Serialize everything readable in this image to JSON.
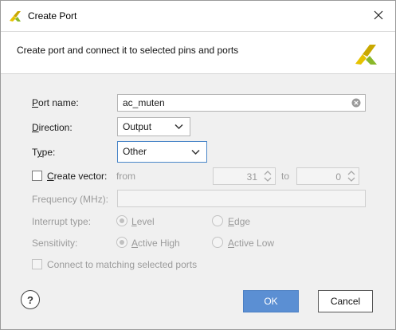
{
  "window": {
    "title": "Create Port"
  },
  "header": {
    "description": "Create port and connect it to selected pins and ports"
  },
  "form": {
    "port_name": {
      "label": "Port name:",
      "value": "ac_muten"
    },
    "direction": {
      "label": "Direction:",
      "value": "Output"
    },
    "type": {
      "label": "Type:",
      "value": "Other"
    },
    "create_vector": {
      "label": "Create vector:",
      "checked": false,
      "from_label": "from",
      "from_value": "31",
      "to_label": "to",
      "to_value": "0"
    },
    "frequency": {
      "label": "Frequency (MHz):",
      "value": ""
    },
    "interrupt_type": {
      "label": "Interrupt type:",
      "options": [
        "Level",
        "Edge"
      ],
      "selected": "Level"
    },
    "sensitivity": {
      "label": "Sensitivity:",
      "options": [
        "Active High",
        "Active Low"
      ],
      "selected": "Active High"
    },
    "connect_matching": {
      "label": "Connect to matching selected ports",
      "checked": false
    }
  },
  "footer": {
    "help_label": "?",
    "ok_label": "OK",
    "cancel_label": "Cancel"
  },
  "colors": {
    "accent": "#5b8fd3",
    "focus_border": "#4a86c8",
    "content_bg": "#f0f0f0",
    "logo_yellow": "#e6c200",
    "logo_green": "#8ab82a"
  }
}
